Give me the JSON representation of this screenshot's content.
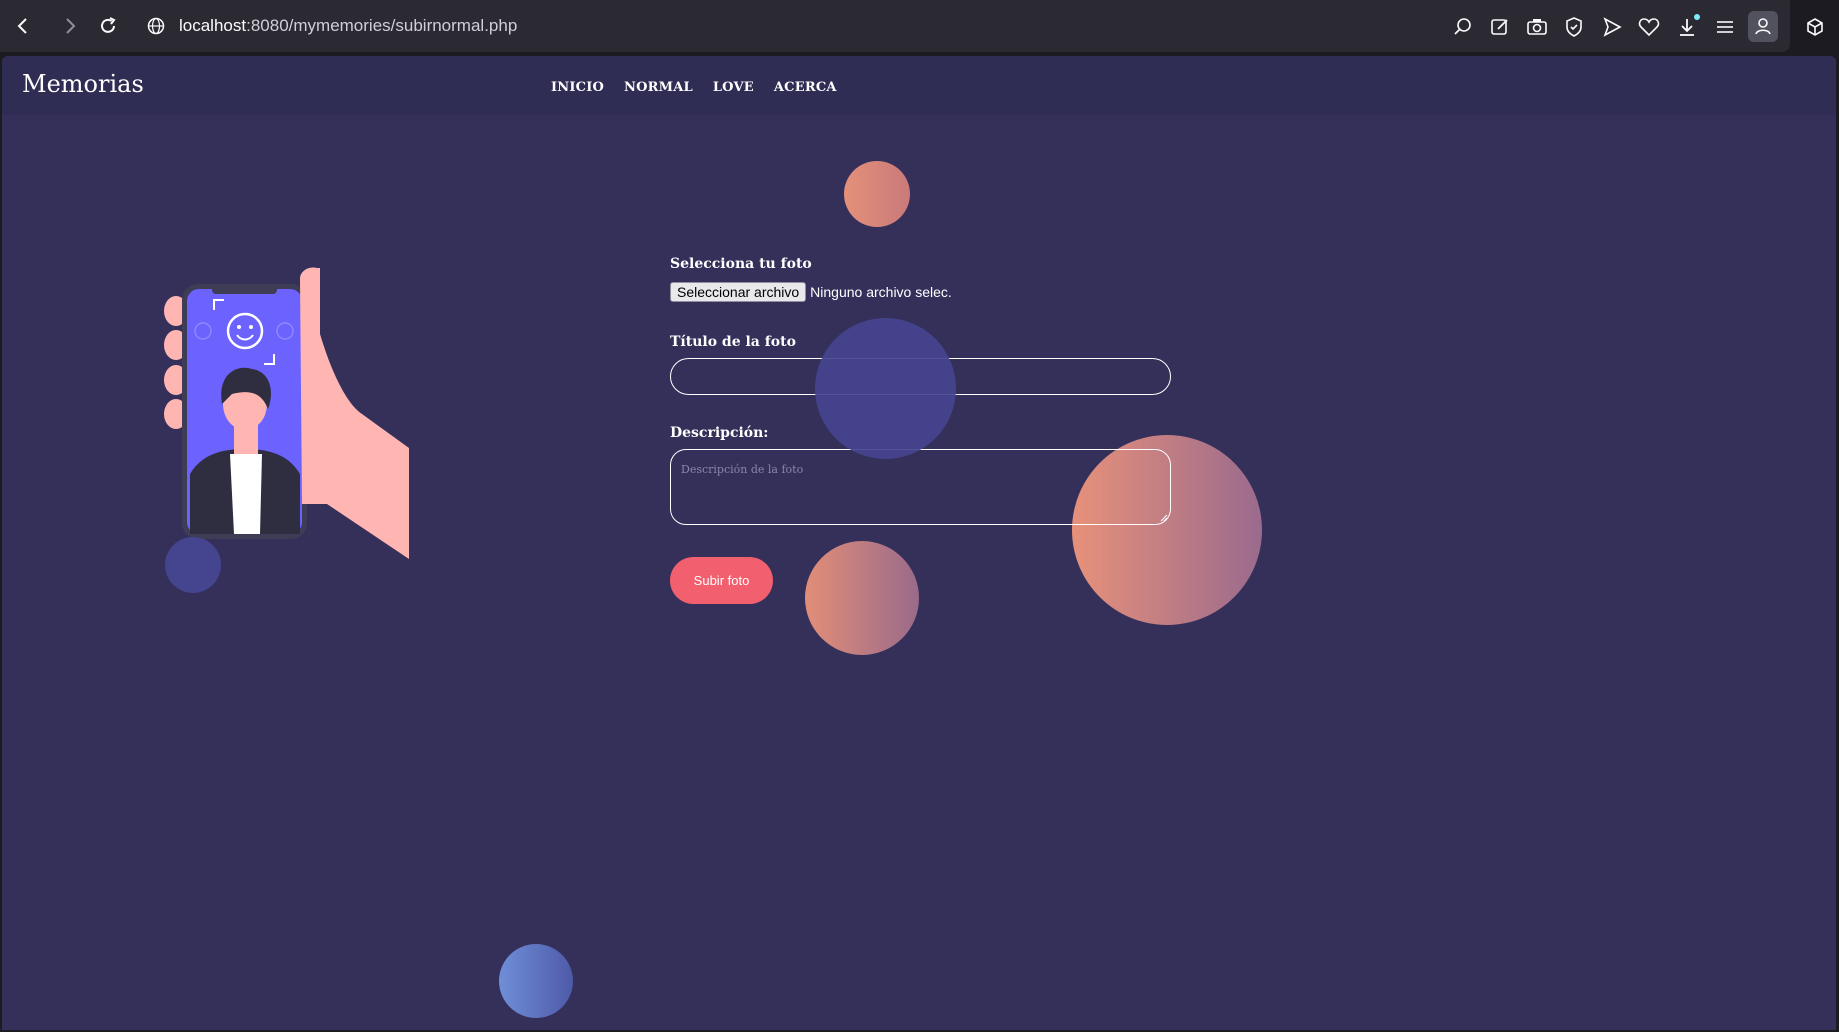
{
  "browser": {
    "url_host": "localhost",
    "url_path": ":8080/mymemories/subirnormal.php"
  },
  "site": {
    "brand": "Memorias",
    "menu": [
      {
        "label": "INICIO"
      },
      {
        "label": "NORMAL"
      },
      {
        "label": "LOVE"
      },
      {
        "label": "ACERCA"
      }
    ]
  },
  "form": {
    "photo_label": "Selecciona tu foto",
    "file_button": "Seleccionar archivo",
    "file_status": "Ninguno archivo selec.",
    "title_label": "Título de la foto",
    "title_value": "",
    "desc_label": "Descripción:",
    "desc_placeholder": "Descripción de la foto",
    "submit_label": "Subir foto"
  },
  "colors": {
    "page_bg": "#34305a",
    "navbar_bg": "#302d54",
    "accent": "#f25f6e",
    "bubble_blue": "#4a4a9a",
    "bubble_peach": "#e08a78",
    "phone_screen": "#6c63ff",
    "hand": "#ffb6b3"
  }
}
